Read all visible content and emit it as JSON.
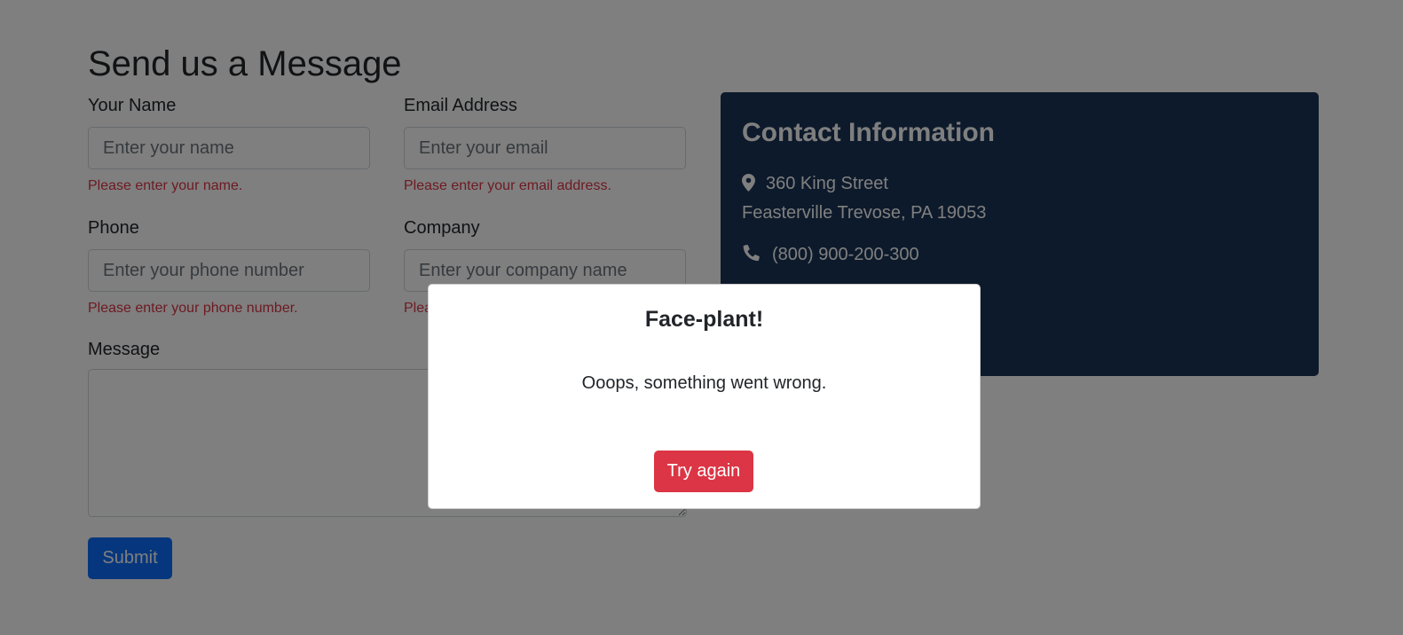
{
  "form": {
    "title": "Send us a Message",
    "name": {
      "label": "Your Name",
      "placeholder": "Enter your name",
      "error": "Please enter your name."
    },
    "email": {
      "label": "Email Address",
      "placeholder": "Enter your email",
      "error": "Please enter your email address."
    },
    "phone": {
      "label": "Phone",
      "placeholder": "Enter your phone number",
      "error": "Please enter your phone number."
    },
    "company": {
      "label": "Company",
      "placeholder": "Enter your company name",
      "error": "Plea"
    },
    "message": {
      "label": "Message"
    },
    "submit_label": "Submit"
  },
  "contact": {
    "title": "Contact Information",
    "address_line1": "360 King Street",
    "address_line2": "Feasterville Trevose, PA 19053",
    "phone": "(800) 900-200-300",
    "icons": {
      "address": "map-pin-icon",
      "phone": "phone-icon"
    }
  },
  "modal": {
    "title": "Face-plant!",
    "message": "Ooops, something went wrong.",
    "button_label": "Try again"
  },
  "colors": {
    "primary": "#0d6efd",
    "danger": "#dc3545",
    "contact_bg": "#1a3456",
    "overlay": "rgba(0,0,0,0.5)"
  }
}
